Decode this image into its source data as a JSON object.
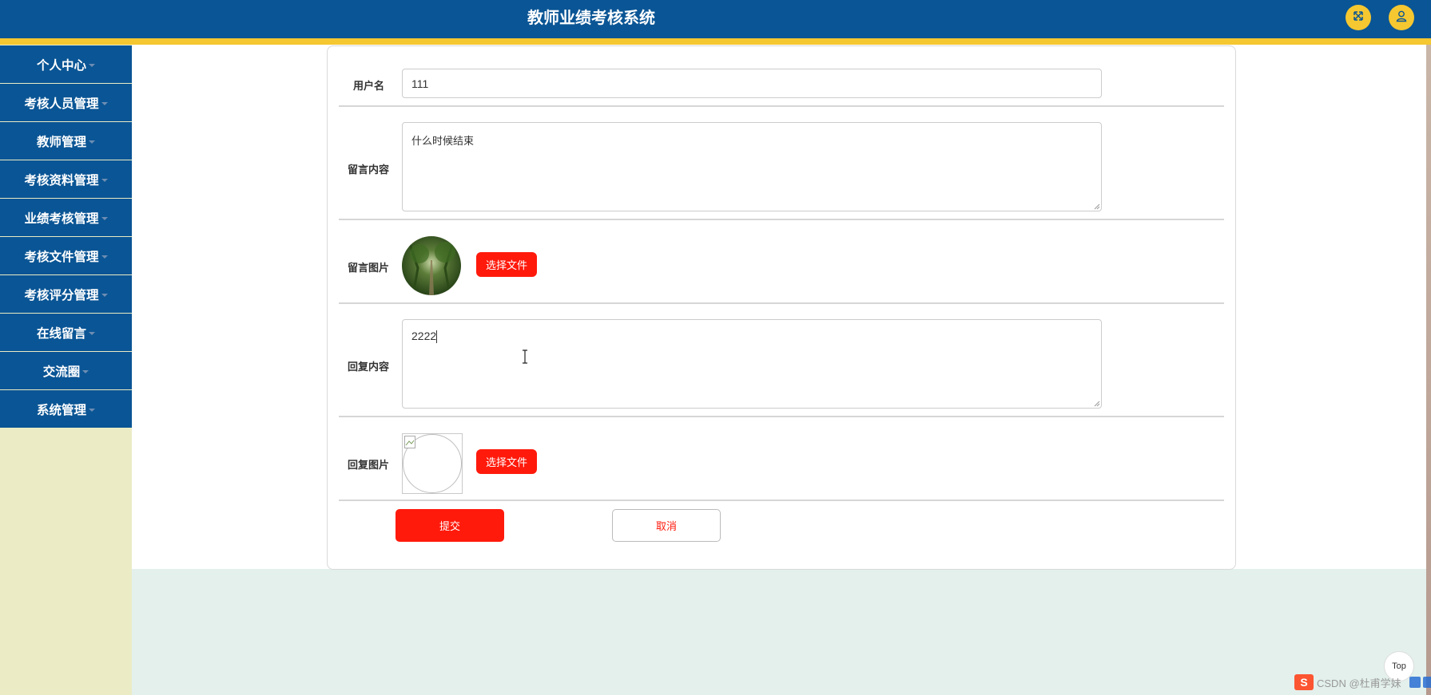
{
  "header": {
    "title": "教师业绩考核系统",
    "fullscreen_icon": "expand-arrows-icon",
    "user_icon": "user-avatar-icon"
  },
  "sidebar": {
    "items": [
      {
        "label": "个人中心"
      },
      {
        "label": "考核人员管理"
      },
      {
        "label": "教师管理"
      },
      {
        "label": "考核资料管理"
      },
      {
        "label": "业绩考核管理"
      },
      {
        "label": "考核文件管理"
      },
      {
        "label": "考核评分管理"
      },
      {
        "label": "在线留言"
      },
      {
        "label": "交流圈"
      },
      {
        "label": "系统管理"
      }
    ]
  },
  "form": {
    "username_label": "用户名",
    "username_value": "111",
    "message_label": "留言内容",
    "message_value": "什么时候结束",
    "message_image_label": "留言图片",
    "reply_label": "回复内容",
    "reply_value": "2222",
    "reply_image_label": "回复图片",
    "choose_file_label": "选择文件",
    "submit_label": "提交",
    "cancel_label": "取消"
  },
  "footer": {
    "top_label": "Top",
    "watermark_text": "CSDN @杜甫学妹",
    "watermark_logo": "S"
  },
  "colors": {
    "header_bg": "#0a5595",
    "accent_yellow": "#f5c730",
    "button_red": "#ff1a0c",
    "sidebar_bg": "#ebecc5",
    "content_bg": "#e3f0ec"
  }
}
